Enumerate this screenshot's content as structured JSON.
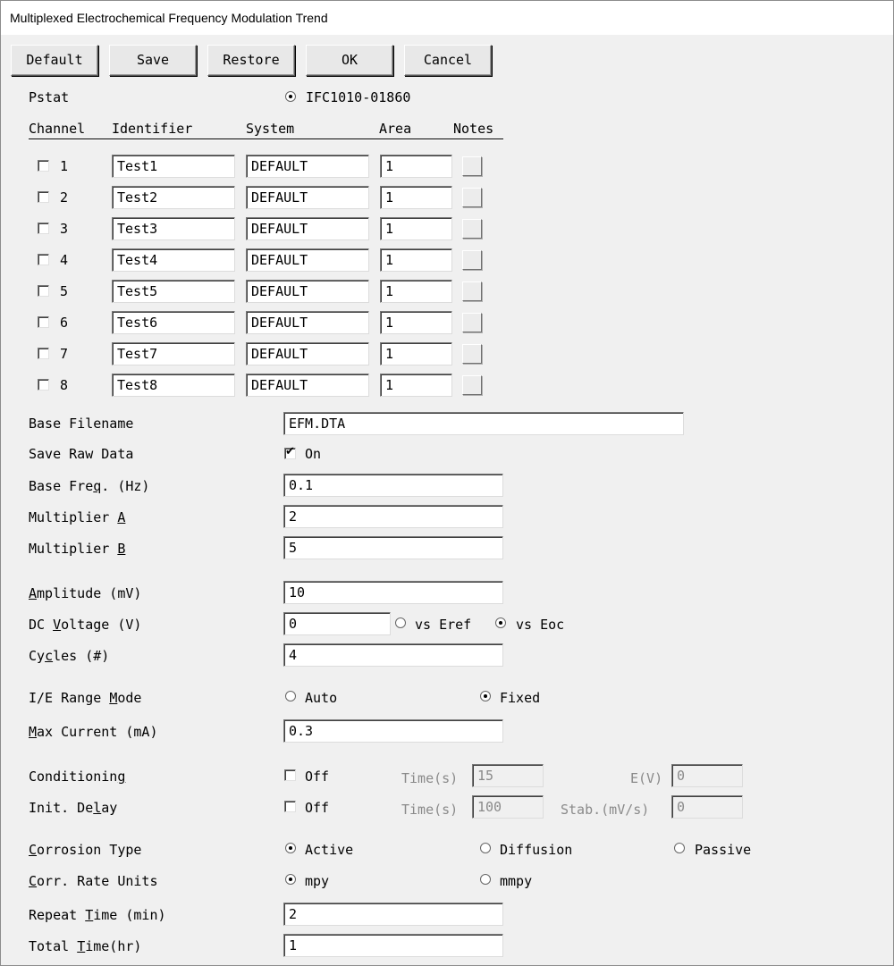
{
  "window": {
    "title": "Multiplexed Electrochemical Frequency Modulation Trend"
  },
  "buttons": {
    "default": "Default",
    "save": "Save",
    "restore": "Restore",
    "ok": "OK",
    "cancel": "Cancel"
  },
  "pstat": {
    "label": "Pstat",
    "value": "IFC1010-01860"
  },
  "table": {
    "headers": {
      "channel": "Channel",
      "identifier": "Identifier",
      "system": "System",
      "area": "Area",
      "notes": "Notes"
    },
    "rows": [
      {
        "channel": "1",
        "checked": false,
        "identifier": "Test1",
        "system": "DEFAULT",
        "area": "1"
      },
      {
        "channel": "2",
        "checked": false,
        "identifier": "Test2",
        "system": "DEFAULT",
        "area": "1"
      },
      {
        "channel": "3",
        "checked": false,
        "identifier": "Test3",
        "system": "DEFAULT",
        "area": "1"
      },
      {
        "channel": "4",
        "checked": false,
        "identifier": "Test4",
        "system": "DEFAULT",
        "area": "1"
      },
      {
        "channel": "5",
        "checked": false,
        "identifier": "Test5",
        "system": "DEFAULT",
        "area": "1"
      },
      {
        "channel": "6",
        "checked": false,
        "identifier": "Test6",
        "system": "DEFAULT",
        "area": "1"
      },
      {
        "channel": "7",
        "checked": false,
        "identifier": "Test7",
        "system": "DEFAULT",
        "area": "1"
      },
      {
        "channel": "8",
        "checked": false,
        "identifier": "Test8",
        "system": "DEFAULT",
        "area": "1"
      }
    ]
  },
  "base_filename": {
    "label": "Base Filename",
    "value": "EFM.DTA"
  },
  "save_raw": {
    "label": "Save Raw Data",
    "option": "On",
    "checked": true
  },
  "base_freq": {
    "label_pre": "Base Fre",
    "label_u": "q",
    "label_post": ". (Hz)",
    "value": "0.1"
  },
  "mult_a": {
    "label_pre": "Multiplier ",
    "label_u": "A",
    "label_post": "",
    "value": "2"
  },
  "mult_b": {
    "label_pre": "Multiplier ",
    "label_u": "B",
    "label_post": "",
    "value": "5"
  },
  "amplitude": {
    "label_pre": "",
    "label_u": "A",
    "label_post": "mplitude (mV)",
    "value": "10"
  },
  "dc_voltage": {
    "label_pre": "DC ",
    "label_u": "V",
    "label_post": "oltage (V)",
    "value": "0",
    "opt_eref": "vs Eref",
    "opt_eoc": "vs Eoc",
    "selected": "vs Eoc"
  },
  "cycles": {
    "label_pre": "Cy",
    "label_u": "c",
    "label_post": "les (#)",
    "value": "4"
  },
  "ie_range": {
    "label_pre": "I/E Range ",
    "label_u": "M",
    "label_post": "ode",
    "opt_auto": "Auto",
    "opt_fixed": "Fixed",
    "selected": "Fixed"
  },
  "max_current": {
    "label_pre": "",
    "label_u": "M",
    "label_post": "ax Current (mA)",
    "value": "0.3"
  },
  "conditioning": {
    "label_pre": "Conditionin",
    "label_u": "g",
    "label_post": "",
    "option": "Off",
    "checked": false,
    "time_label": "Time(s)",
    "time_value": "15",
    "e_label": "E(V)",
    "e_value": "0"
  },
  "init_delay": {
    "label_pre": "Init. De",
    "label_u": "l",
    "label_post": "ay",
    "option": "Off",
    "checked": false,
    "time_label": "Time(s)",
    "time_value": "100",
    "stab_label": "Stab.(mV/s)",
    "stab_value": "0"
  },
  "corrosion_type": {
    "label_pre": "",
    "label_u": "C",
    "label_post": "orrosion Type",
    "opt_active": "Active",
    "opt_diffusion": "Diffusion",
    "opt_passive": "Passive",
    "selected": "Active"
  },
  "corr_units": {
    "label_pre": "",
    "label_u": "C",
    "label_post": "orr. Rate Units",
    "opt_mpy": "mpy",
    "opt_mmpy": "mmpy",
    "selected": "mpy"
  },
  "repeat_time": {
    "label_pre": "Repeat ",
    "label_u": "T",
    "label_post": "ime (min)",
    "value": "2"
  },
  "total_time": {
    "label_pre": "Total ",
    "label_u": "T",
    "label_post": "ime(hr)",
    "value": "1"
  }
}
